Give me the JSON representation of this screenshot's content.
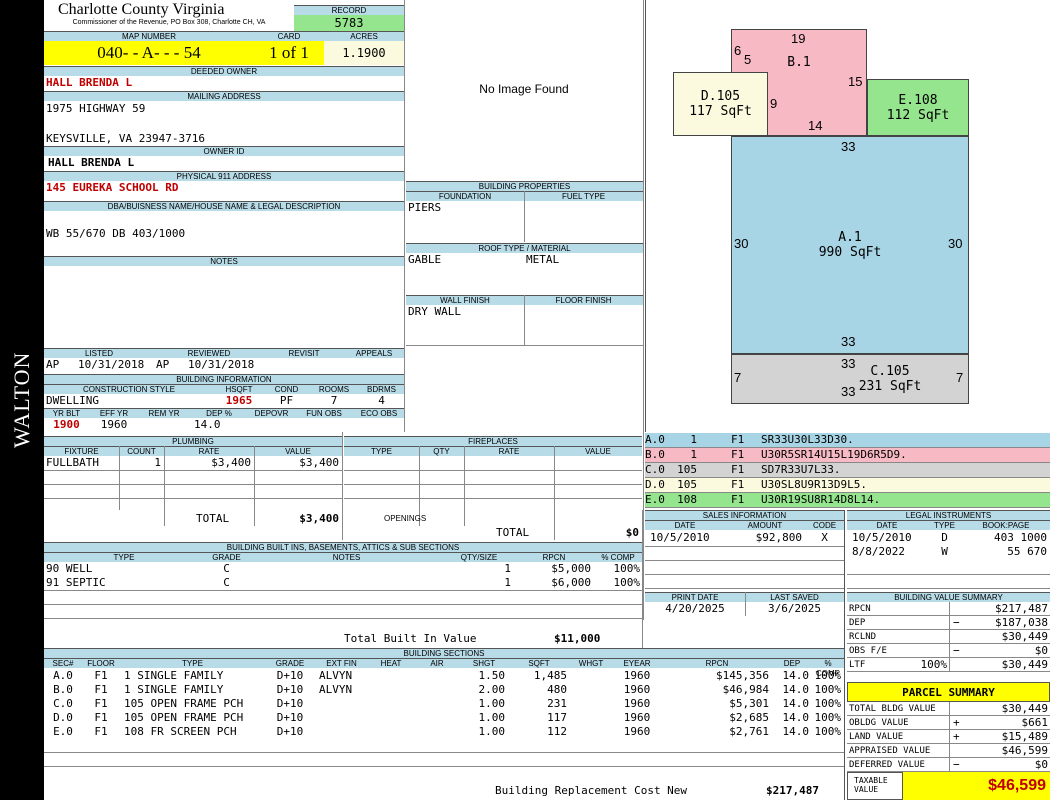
{
  "side_label": "WALTON",
  "header": {
    "county": "Charlotte County Virginia",
    "commissioner": "Commissioner of the Revenue, PO Box 308, Charlotte CH, VA",
    "record_label": "RECORD",
    "record": "5783",
    "map_label": "MAP NUMBER",
    "map": "040- - A- - - 54",
    "card_label": "CARD",
    "card": "1 of 1",
    "acres_label": "ACRES",
    "acres": "1.1900"
  },
  "owner": {
    "deeded_label": "DEEDED OWNER",
    "deeded": "HALL BRENDA L",
    "mailing_label": "MAILING ADDRESS",
    "addr1": "1975 HIGHWAY 59",
    "addr2": "KEYSVILLE, VA 23947-3716",
    "owner_id_label": "OWNER ID",
    "owner_id": "HALL BRENDA L",
    "physical_label": "PHYSICAL 911 ADDRESS",
    "physical": "145 EUREKA SCHOOL RD",
    "dba_label": "DBA/BUISNESS NAME/HOUSE NAME & LEGAL DESCRIPTION",
    "legal": "WB 55/670 DB 403/1000",
    "notes_label": "NOTES"
  },
  "image": {
    "text": "No Image Found"
  },
  "bldg_props": {
    "title": "BUILDING PROPERTIES",
    "foundation_label": "FOUNDATION",
    "fuel_label": "FUEL TYPE",
    "foundation": "PIERS",
    "roof_label": "ROOF TYPE / MATERIAL",
    "roof_type": "GABLE",
    "roof_mat": "METAL",
    "wall_label": "WALL FINISH",
    "floor_label": "FLOOR FINISH",
    "wall": "DRY WALL"
  },
  "review": {
    "listed_label": "LISTED",
    "reviewed_label": "REVIEWED",
    "revisit_label": "REVISIT",
    "appeals_label": "APPEALS",
    "listed_by": "AP",
    "listed": "10/31/2018",
    "reviewed_by": "AP",
    "reviewed": "10/31/2018"
  },
  "bldg_info": {
    "title": "BUILDING INFORMATION",
    "style_label": "CONSTRUCTION STYLE",
    "hsqft_label": "HSQFT",
    "cond_label": "COND",
    "rooms_label": "ROOMS",
    "bdrms_label": "BDRMS",
    "style": "DWELLING",
    "hsqft": "1965",
    "cond": "PF",
    "rooms": "7",
    "bdrms": "4",
    "yrblt_label": "YR BLT",
    "effyr_label": "EFF YR",
    "remyr_label": "REM YR",
    "dep_label": "DEP %",
    "depovr_label": "DEPOVR",
    "funobs_label": "FUN OBS",
    "ecoobs_label": "ECO OBS",
    "yrblt": "1900",
    "effyr": "1960",
    "dep": "14.0"
  },
  "plumbing": {
    "title": "PLUMBING",
    "headers": [
      "FIXTURE",
      "COUNT",
      "RATE",
      "VALUE"
    ],
    "rows": [
      [
        "FULLBATH",
        "1",
        "$3,400",
        "$3,400"
      ]
    ],
    "total_label": "TOTAL",
    "total": "$3,400"
  },
  "fireplaces": {
    "title": "FIREPLACES",
    "headers": [
      "TYPE",
      "QTY",
      "RATE",
      "VALUE"
    ],
    "openings_label": "OPENINGS",
    "total_label": "TOTAL",
    "total": "$0"
  },
  "builtins": {
    "title": "BUILDING BUILT INS, BASEMENTS, ATTICS & SUB SECTIONS",
    "headers": [
      "TYPE",
      "GRADE",
      "NOTES",
      "QTY/SIZE",
      "RPCN",
      "% COMP"
    ],
    "rows": [
      [
        "90 WELL",
        "C",
        "",
        "1",
        "$5,000",
        "100%"
      ],
      [
        "91 SEPTIC",
        "C",
        "",
        "1",
        "$6,000",
        "100%"
      ]
    ],
    "total_label": "Total Built In Value",
    "total": "$11,000"
  },
  "sections": {
    "title": "BUILDING SECTIONS",
    "headers": [
      "SEC#",
      "FLOOR",
      "TYPE",
      "GRADE",
      "EXT FIN",
      "HEAT",
      "AIR",
      "SHGT",
      "SQFT",
      "WHGT",
      "EYEAR",
      "RPCN",
      "DEP",
      "% COMP"
    ],
    "rows": [
      [
        "A.0",
        "F1",
        "1 SINGLE FAMILY",
        "D+10",
        "ALVYN",
        "",
        "",
        "1.50",
        "1,485",
        "",
        "1960",
        "$145,356",
        "14.0",
        "100%"
      ],
      [
        "B.0",
        "F1",
        "1 SINGLE FAMILY",
        "D+10",
        "ALVYN",
        "",
        "",
        "2.00",
        "480",
        "",
        "1960",
        "$46,984",
        "14.0",
        "100%"
      ],
      [
        "C.0",
        "F1",
        "105 OPEN FRAME PCH",
        "D+10",
        "",
        "",
        "",
        "1.00",
        "231",
        "",
        "1960",
        "$5,301",
        "14.0",
        "100%"
      ],
      [
        "D.0",
        "F1",
        "105 OPEN FRAME PCH",
        "D+10",
        "",
        "",
        "",
        "1.00",
        "117",
        "",
        "1960",
        "$2,685",
        "14.0",
        "100%"
      ],
      [
        "E.0",
        "F1",
        "108 FR SCREEN PCH",
        "D+10",
        "",
        "",
        "",
        "1.00",
        "112",
        "",
        "1960",
        "$2,761",
        "14.0",
        "100%"
      ]
    ],
    "total_label": "Building Replacement Cost New",
    "total": "$217,487"
  },
  "sketch": {
    "areas": [
      {
        "id": "B.1",
        "color": "#f7b9c3"
      },
      {
        "id": "D.105",
        "label": "117 SqFt",
        "color": "#fcfade"
      },
      {
        "id": "E.108",
        "label": "112 SqFt",
        "color": "#95e58e"
      },
      {
        "id": "A.1",
        "label": "990 SqFt",
        "color": "#a8d5e5"
      },
      {
        "id": "C.105",
        "label": "231 SqFt",
        "color": "#d3d3d3"
      }
    ],
    "dims": [
      "19",
      "6",
      "5",
      "15",
      "9",
      "14",
      "33",
      "30",
      "30",
      "33",
      "33",
      "7",
      "7",
      "33"
    ],
    "legend": [
      {
        "sec": "A.0",
        "a": "1",
        "f": "F1",
        "code": "SR33U30L33D30.",
        "color": "#a8d5e5"
      },
      {
        "sec": "B.0",
        "a": "1",
        "f": "F1",
        "code": "U30R5SR14U15L19D6R5D9.",
        "color": "#f7b9c3"
      },
      {
        "sec": "C.0",
        "a": "105",
        "f": "F1",
        "code": "SD7R33U7L33.",
        "color": "#d3d3d3"
      },
      {
        "sec": "D.0",
        "a": "105",
        "f": "F1",
        "code": "U30SL8U9R13D9L5.",
        "color": "#fcfade"
      },
      {
        "sec": "E.0",
        "a": "108",
        "f": "F1",
        "code": "U30R19SU8R14D8L14.",
        "color": "#95e58e"
      }
    ]
  },
  "sales": {
    "title": "SALES INFORMATION",
    "headers": [
      "DATE",
      "AMOUNT",
      "CODE"
    ],
    "rows": [
      [
        "10/5/2010",
        "$92,800",
        "X"
      ]
    ]
  },
  "legal_inst": {
    "title": "LEGAL INSTRUMENTS",
    "headers": [
      "DATE",
      "TYPE",
      "BOOK:PAGE"
    ],
    "rows": [
      [
        "10/5/2010",
        "D",
        "403 1000"
      ],
      [
        "8/8/2022",
        "W",
        "55 670"
      ]
    ]
  },
  "dates": {
    "print_label": "PRINT DATE",
    "saved_label": "LAST SAVED",
    "print": "4/20/2025",
    "saved": "3/6/2025"
  },
  "value_summary": {
    "title": "BUILDING VALUE SUMMARY",
    "rows": [
      {
        "label": "RPCN",
        "sign": "",
        "value": "$217,487"
      },
      {
        "label": "DEP",
        "sign": "−",
        "value": "$187,038"
      },
      {
        "label": "RCLND",
        "sign": "",
        "value": "$30,449"
      },
      {
        "label": "OBS F/E",
        "sign": "−",
        "value": "$0"
      },
      {
        "label": "LTF",
        "pct": "100%",
        "sign": "",
        "value": "$30,449"
      }
    ]
  },
  "parcel": {
    "title": "PARCEL SUMMARY",
    "rows": [
      {
        "label": "TOTAL BLDG VALUE",
        "sign": "",
        "value": "$30,449"
      },
      {
        "label": "OBLDG VALUE",
        "sign": "+",
        "value": "$661"
      },
      {
        "label": "LAND VALUE",
        "sign": "+",
        "value": "$15,489"
      },
      {
        "label": "APPRAISED VALUE",
        "sign": "",
        "value": "$46,599"
      },
      {
        "label": "DEFERRED VALUE",
        "sign": "−",
        "value": "$0"
      }
    ],
    "taxable_label1": "TAXABLE",
    "taxable_label2": "VALUE",
    "taxable": "$46,599"
  }
}
